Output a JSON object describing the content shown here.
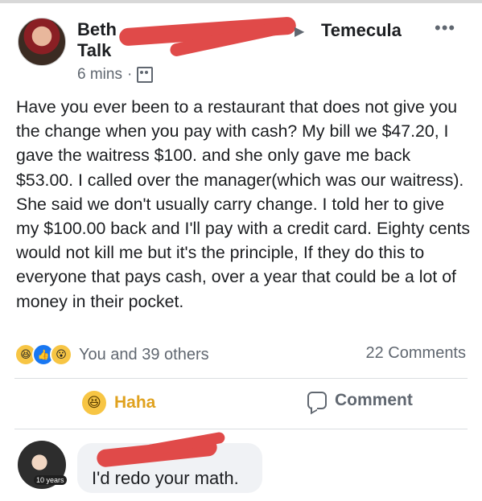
{
  "post": {
    "author_first": "Beth",
    "author_second": "Talk",
    "location": "Temecula",
    "timestamp": "6 mins",
    "separator": "·",
    "more": "•••",
    "text": "Have you ever been to a restaurant that does not give you the change when you pay with cash? My bill we $47.20, I gave the waitress $100. and she only gave me back $53.00. I called over the manager(which was our waitress). She said we don't usually carry change. I told her to give my $100.00 back and I'll pay with a credit card. Eighty cents would not kill me but it's the principle, If they do this to everyone that pays cash, over a year that could be a lot of money in their pocket."
  },
  "engagement": {
    "reactions_text": "You and 39 others",
    "comments_count": "22 Comments"
  },
  "actions": {
    "haha_label": "Haha",
    "comment_label": "Comment"
  },
  "comment": {
    "text": "I'd redo your math.",
    "badge": "10 years"
  },
  "colors": {
    "haha_yellow": "#f7c544",
    "like_blue": "#1877f2",
    "redaction_red": "#e04a49"
  }
}
